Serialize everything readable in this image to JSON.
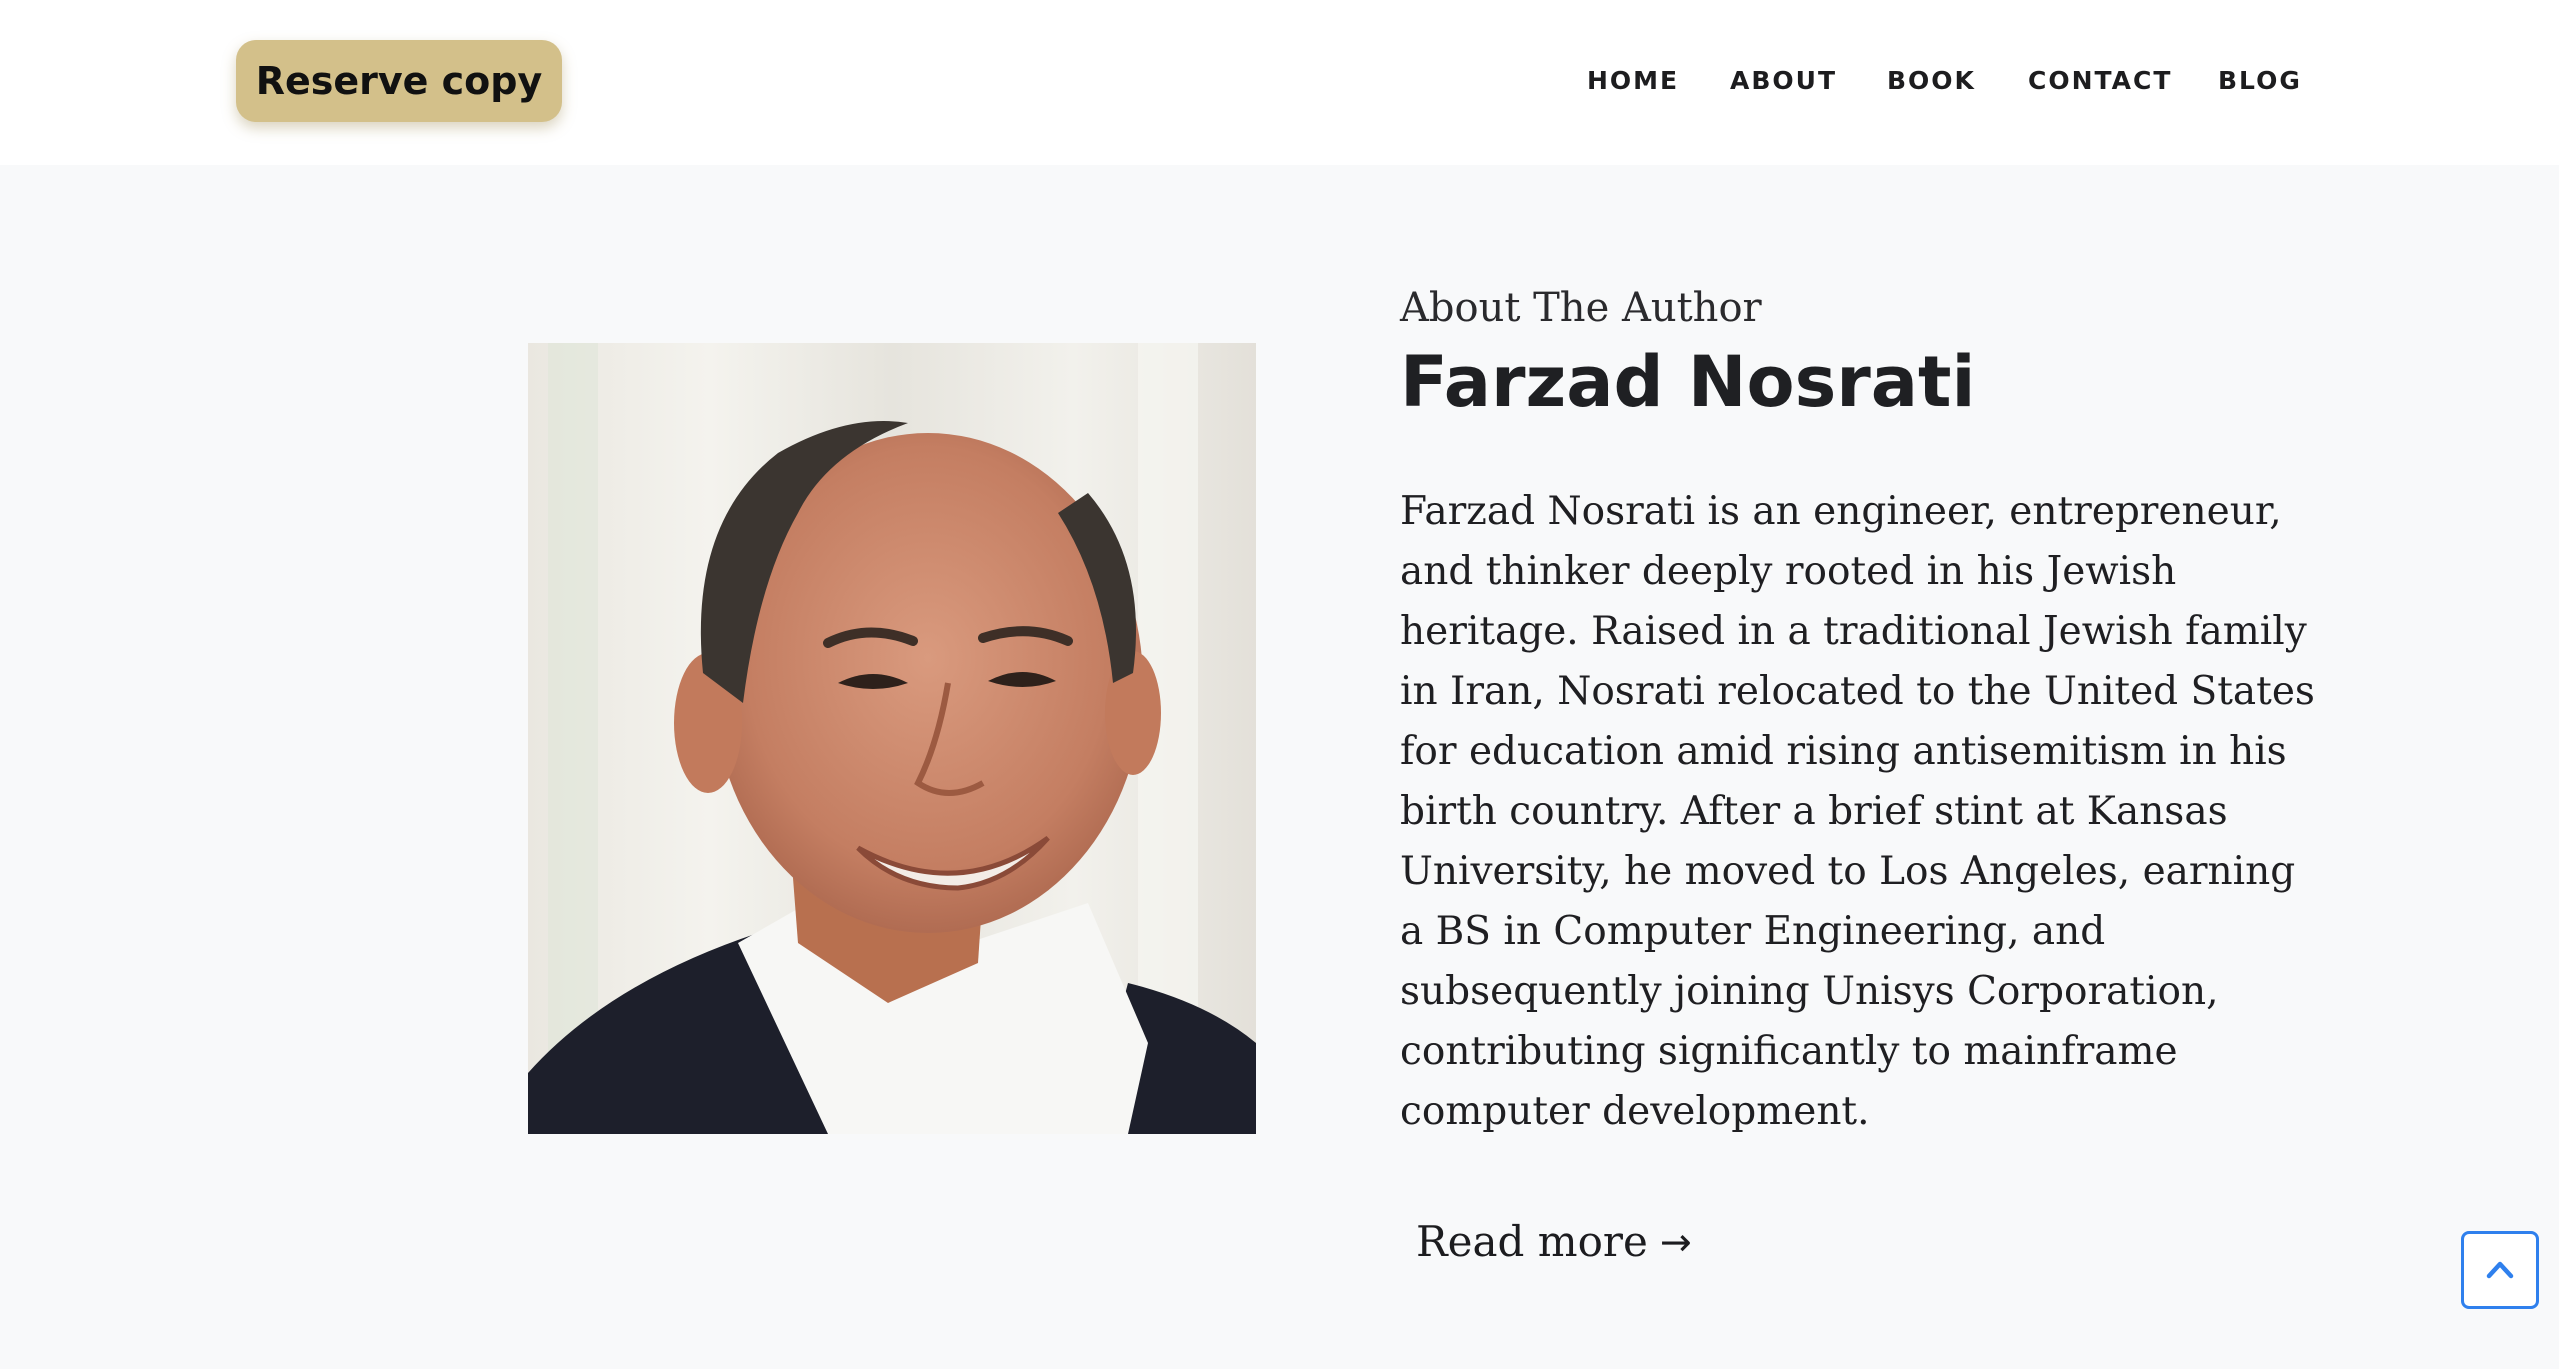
{
  "header": {
    "cta_label": "Reserve copy",
    "nav": [
      {
        "label": "HOME"
      },
      {
        "label": "ABOUT"
      },
      {
        "label": "BOOK"
      },
      {
        "label": "CONTACT"
      },
      {
        "label": "BLOG"
      }
    ]
  },
  "author": {
    "kicker": "About The Author",
    "name": "Farzad Nosrati",
    "bio": "Farzad Nosrati is an engineer, entrepreneur, and thinker deeply rooted in his Jewish heritage. Raised in a traditional Jewish family in Iran, Nosrati relocated to the United States for education amid rising antisemitism in his birth country. After a brief stint at Kansas University, he moved to Los Angeles, earning a BS in Computer Engineering, and subsequently joining Unisys Corporation, contributing significantly to mainframe computer development.",
    "read_more_label": "Read more",
    "read_more_arrow": "→"
  },
  "colors": {
    "cta_background": "#d3c08a",
    "page_background": "#f8f9fa",
    "header_background": "#ffffff",
    "scroll_top_accent": "#2f80ed"
  },
  "icons": {
    "scroll_top": "chevron-up-icon",
    "read_more": "arrow-right-icon"
  }
}
